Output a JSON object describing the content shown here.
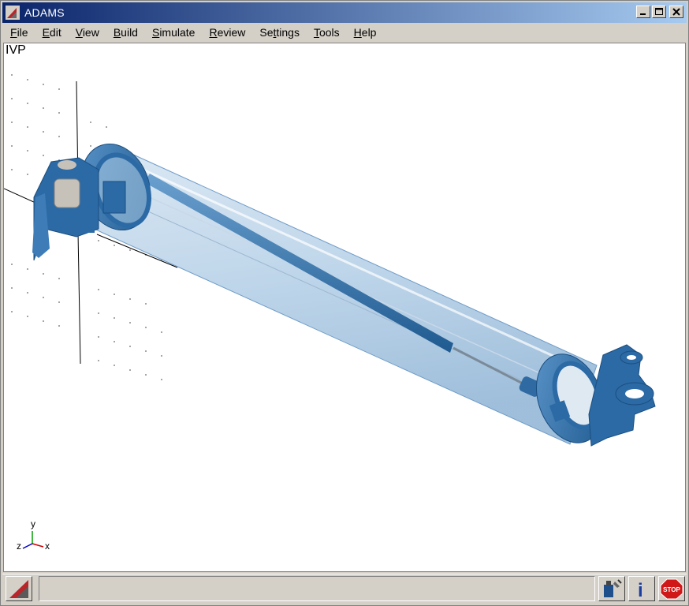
{
  "window": {
    "title": "ADAMS",
    "controls": {
      "minimize_icon": "minimize-icon",
      "maximize_icon": "maximize-icon",
      "close_icon": "close-icon"
    }
  },
  "menu": [
    {
      "label": "File"
    },
    {
      "label": "Edit"
    },
    {
      "label": "View"
    },
    {
      "label": "Build"
    },
    {
      "label": "Simulate"
    },
    {
      "label": "Review"
    },
    {
      "label": "Settings"
    },
    {
      "label": "Tools"
    },
    {
      "label": "Help"
    }
  ],
  "viewport": {
    "view_name": "IVP",
    "triad": {
      "y": "y",
      "z": "z",
      "x": "x"
    },
    "model_color": "#3a74a8"
  },
  "bottom_toolbar": {
    "icons": [
      "adams-logo-icon",
      "tools-icon",
      "info-icon",
      "stop-icon"
    ],
    "stop_label": "STOP",
    "info_label": "i"
  }
}
